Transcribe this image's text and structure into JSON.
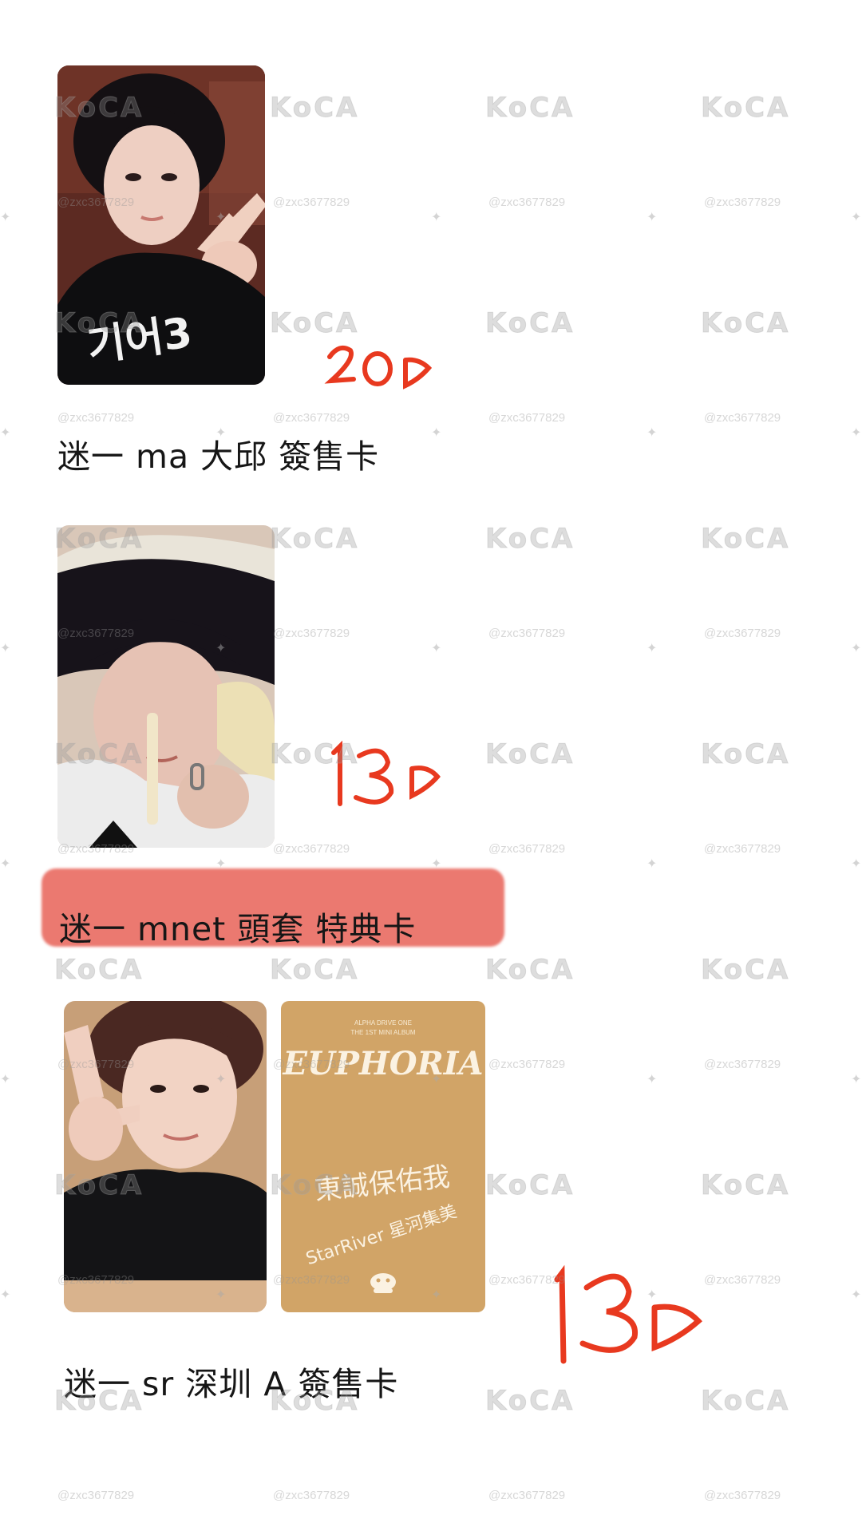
{
  "items": [
    {
      "caption": "迷一 ma 大邱 簽售卡",
      "price": "200"
    },
    {
      "caption": "迷一 mnet 頭套 特典卡",
      "price": "130"
    },
    {
      "caption": "迷一 sr 深圳 A 簽售卡",
      "price": "130"
    }
  ],
  "watermark": {
    "logo": "KoCA",
    "user": "@zxc3677829"
  },
  "card_back": {
    "header_line1": "ALPHA DRIVE ONE",
    "header_line2": "THE 1ST MINI ALBUM",
    "title": "EUPHORIA",
    "chinese": "東誠保佑我",
    "store": "StarRiver 星河集美"
  },
  "sweater_text": "기어3",
  "colors": {
    "price_ink": "#e8391f",
    "highlight": "#e96e64",
    "card_back_bg": "#d1a467"
  }
}
